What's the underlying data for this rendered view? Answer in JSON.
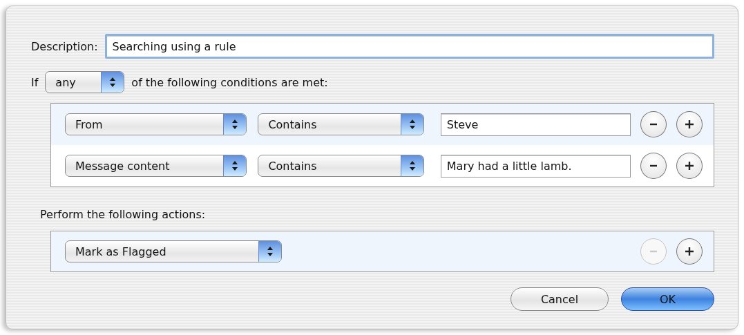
{
  "description": {
    "label": "Description:",
    "value": "Searching using a rule"
  },
  "condition_line": {
    "prefix": "If",
    "match": "any",
    "suffix": "of the following conditions are met:"
  },
  "conditions": [
    {
      "field": "From",
      "operator": "Contains",
      "value": "Steve",
      "remove_disabled": false
    },
    {
      "field": "Message content",
      "operator": "Contains",
      "value": "Mary had a little lamb.",
      "remove_disabled": false
    }
  ],
  "actions_label": "Perform the following actions:",
  "actions": [
    {
      "action": "Mark as Flagged",
      "remove_disabled": true
    }
  ],
  "buttons": [
    {
      "label": "Cancel",
      "default": false
    },
    {
      "label": "OK",
      "default": true
    }
  ]
}
